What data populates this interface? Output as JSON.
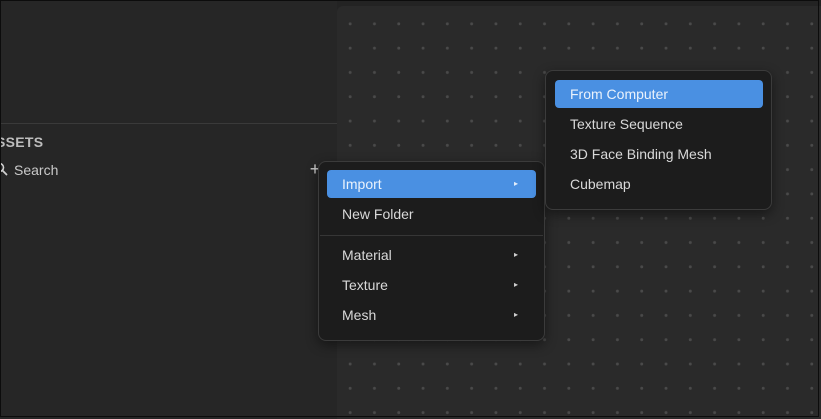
{
  "assets_panel": {
    "title": "SSETS",
    "search_label": "Search",
    "add_label": "+"
  },
  "context_menu": {
    "items": [
      {
        "label": "Import",
        "arrow": "▸"
      },
      {
        "label": "New Folder"
      },
      {
        "label": "Material",
        "arrow": "▸"
      },
      {
        "label": "Texture",
        "arrow": "▸"
      },
      {
        "label": "Mesh",
        "arrow": "▸"
      }
    ]
  },
  "import_submenu": {
    "items": [
      {
        "label": "From Computer"
      },
      {
        "label": "Texture Sequence"
      },
      {
        "label": "3D Face Binding Mesh"
      },
      {
        "label": "Cubemap"
      }
    ]
  },
  "colors": {
    "accent": "#4a90e2",
    "menu_background": "#1c1c1c",
    "panel_background": "#262626",
    "viewport_background": "#2a2a2a"
  }
}
